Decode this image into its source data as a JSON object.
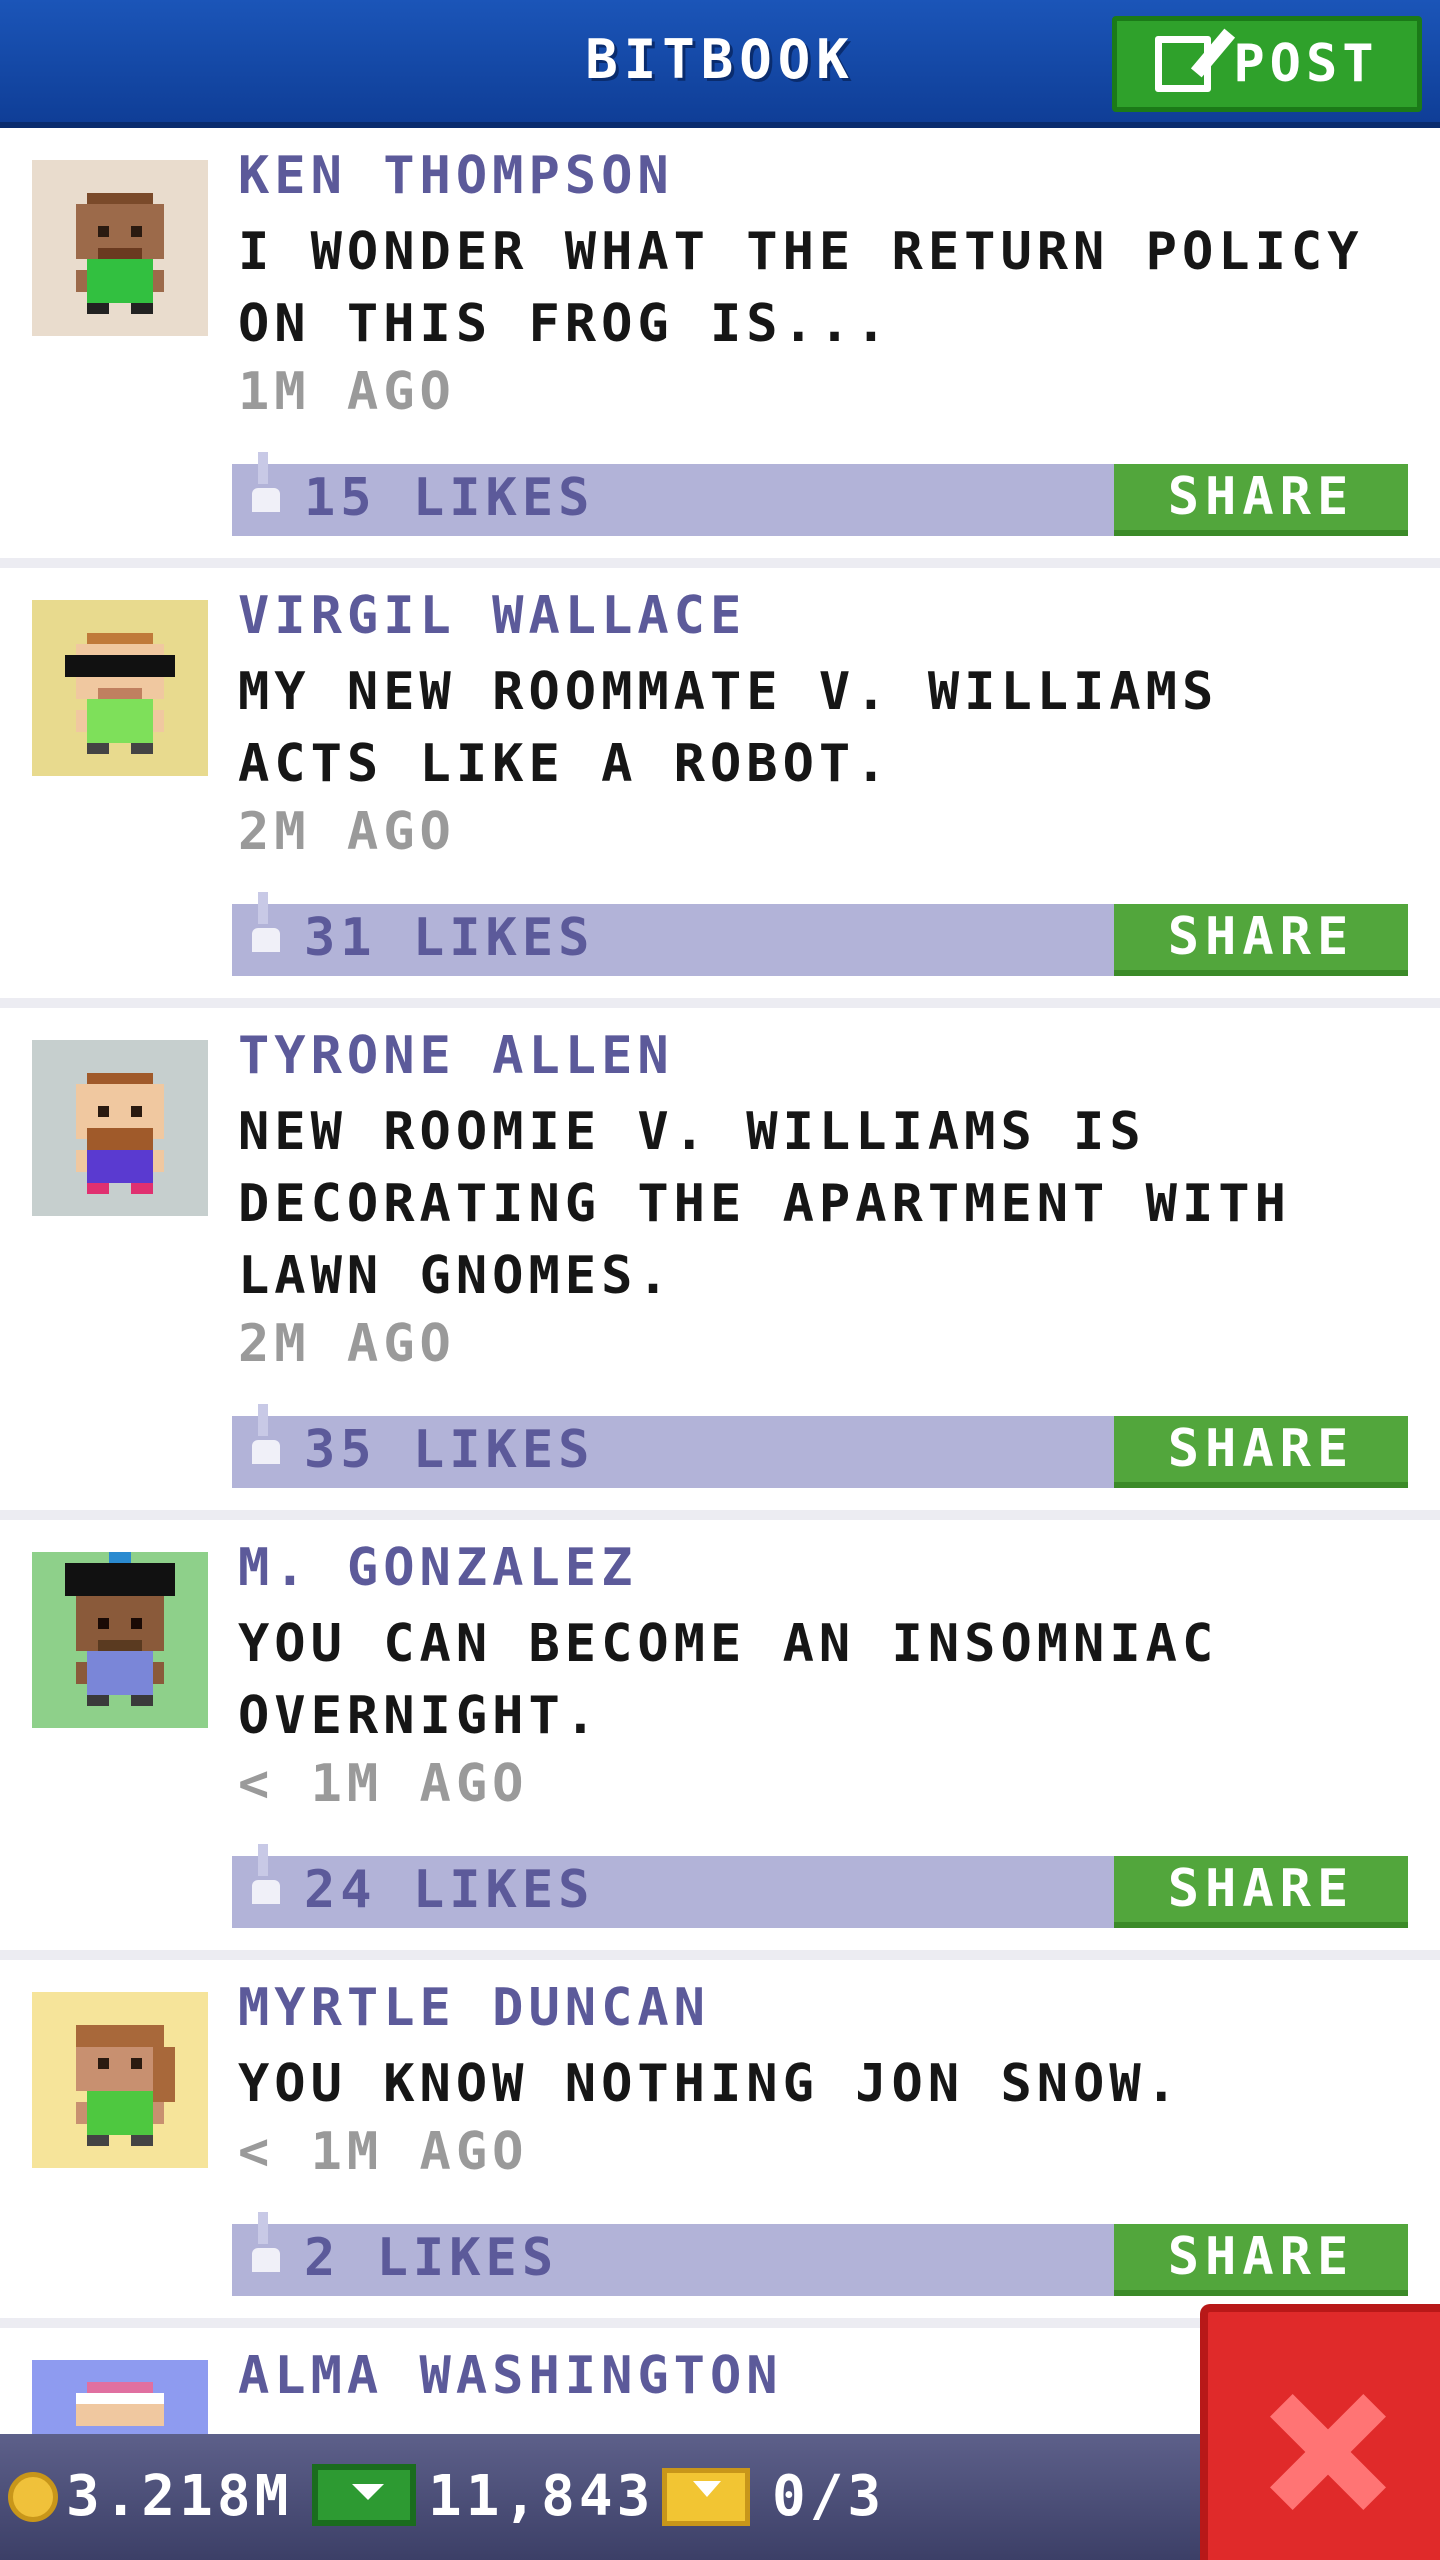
{
  "header": {
    "title": "BITBOOK",
    "post_label": "POST"
  },
  "posts": [
    {
      "author": "KEN THOMPSON",
      "message": "I WONDER WHAT THE RETURN POLICY ON THIS FROG IS...",
      "time": "1M AGO",
      "likes": "15 LIKES",
      "share_label": "SHARE",
      "avatar_bg": "#e9dccd"
    },
    {
      "author": "VIRGIL WALLACE",
      "message": "MY NEW ROOMMATE V. WILLIAMS ACTS LIKE A ROBOT.",
      "time": "2M AGO",
      "likes": "31 LIKES",
      "share_label": "SHARE",
      "avatar_bg": "#e8da8e"
    },
    {
      "author": "TYRONE ALLEN",
      "message": "NEW ROOMIE V. WILLIAMS IS DECORATING THE APARTMENT WITH LAWN GNOMES.",
      "time": "2M AGO",
      "likes": "35 LIKES",
      "share_label": "SHARE",
      "avatar_bg": "#c6cfce"
    },
    {
      "author": "M. GONZALEZ",
      "message": "YOU CAN BECOME AN INSOMNIAC OVERNIGHT.",
      "time": "< 1M AGO",
      "likes": "24 LIKES",
      "share_label": "SHARE",
      "avatar_bg": "#8ed08a"
    },
    {
      "author": "MYRTLE DUNCAN",
      "message": "YOU KNOW NOTHING JON SNOW.",
      "time": "< 1M AGO",
      "likes": "2 LIKES",
      "share_label": "SHARE",
      "avatar_bg": "#f6e49a"
    },
    {
      "author": "ALMA WASHINGTON",
      "avatar_bg": "#8e9bf0"
    }
  ],
  "status": {
    "coins": "3.218M",
    "bux": "11,843",
    "tickets": "0/3"
  },
  "colors": {
    "header_blue": "#1b55b8",
    "share_green": "#52a63c",
    "likes_bar": "#b2b3d8",
    "author_text": "#5c5a9a",
    "close_red": "#e02a2a"
  }
}
